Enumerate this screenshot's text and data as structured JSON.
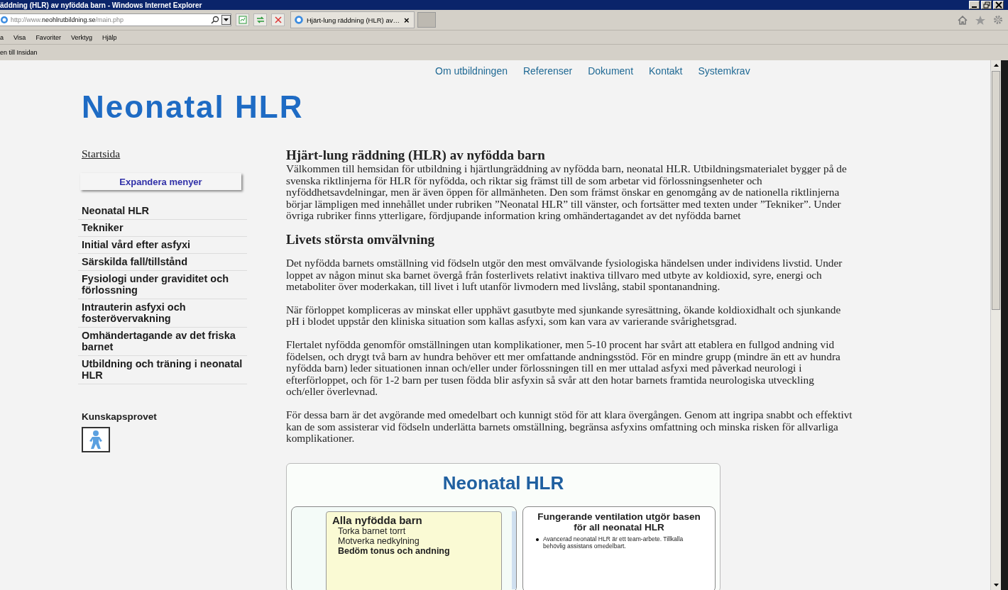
{
  "window": {
    "title": "äddning (HLR) av nyfödda barn - Windows Internet Explorer"
  },
  "address_bar": {
    "scheme": "http://www.",
    "domain": "neohlrutbildning.se",
    "path": "/main.php"
  },
  "tabs": [
    {
      "title": "Hjärt-lung räddning (HLR) av…",
      "selected": true,
      "close": "×"
    }
  ],
  "menu_bar": [
    "a",
    "Visa",
    "Favoriter",
    "Verktyg",
    "Hjälp"
  ],
  "favorites_bar": [
    "en till Insidan"
  ],
  "page": {
    "nav": [
      "Om utbildningen",
      "Referenser",
      "Dokument",
      "Kontakt",
      "Systemkrav"
    ],
    "logo": "Neonatal HLR",
    "sidebar": {
      "home_link": "Startsida",
      "expand_button": "Expandera menyer",
      "items": [
        "Neonatal HLR",
        "Tekniker",
        "Initial vård efter asfyxi",
        "Särskilda fall/tillstånd",
        "Fysiologi under graviditet och förlossning",
        "Intrauterin asfyxi och fosterövervakning",
        "Omhändertagande av det friska barnet",
        "Utbildning och träning i neonatal HLR"
      ],
      "quiz_label": "Kunskapsprovet"
    },
    "sections": [
      {
        "heading": "Hjärt-lung räddning (HLR) av nyfödda barn",
        "paragraphs": [
          "Välkommen till hemsidan för utbildning i hjärtlungräddning av nyfödda barn, neonatal HLR. Utbildningsmaterialet bygger på de svenska riktlinjerna för HLR för nyfödda, och riktar sig främst till de som arbetar vid förlossningsenheter och nyföddhetsavdelningar, men är även öppen för allmänheten. Den som främst önskar en genomgång av de nationella riktlinjerna börjar lämpligen med innehållet under rubriken ”Neonatal HLR” till vänster, och fortsätter med texten under ”Tekniker”. Under övriga rubriker finns ytterligare, fördjupande information kring omhändertagandet av det nyfödda barnet"
        ]
      },
      {
        "heading": "Livets största omvälvning",
        "paragraphs": [
          "Det nyfödda barnets omställning vid födseln utgör den mest omvälvande fysiologiska händelsen under individens livstid. Under loppet av någon minut ska barnet övergå från fosterlivets relativt inaktiva tillvaro med utbyte av koldioxid, syre, energi och metaboliter över moderkakan, till livet i luft utanför livmodern med livslång, stabil spontanandning.",
          "När förloppet kompliceras av minskat eller upphävt gasutbyte med sjunkande syresättning, ökande koldioxidhalt och sjunkande pH i blodet uppstår den kliniska situation som kallas asfyxi, som kan vara av varierande svårighetsgrad.",
          "Flertalet nyfödda genomför omställningen utan komplikationer, men 5-10 procent har svårt att etablera en fullgod andning vid födelsen, och drygt två barn av hundra behöver ett mer omfattande andningsstöd. För en mindre grupp (mindre än ett av hundra nyfödda barn) leder situationen innan och/eller under förlossningen till en mer uttalad asfyxi med påverkad neurologi i efterförloppet, och för 1-2 barn per tusen födda blir asfyxin så svår att den hotar barnets framtida neurologiska utveckling och/eller överlevnad.",
          "För dessa barn är det avgörande med omedelbart och kunnigt stöd för att klara övergången. Genom att ingripa snabbt och effektivt kan de som assisterar vid födseln underlätta barnets omställning, begränsa asfyxins omfattning och minska risken för allvarliga komplikationer."
        ]
      }
    ],
    "diagram": {
      "title": "Neonatal HLR",
      "left_box": {
        "heading": "Alla nyfödda barn",
        "lines": [
          {
            "text": "Torka barnet torrt",
            "bold": false
          },
          {
            "text": "Motverka nedkylning",
            "bold": false
          },
          {
            "text": "Bedöm tonus och andning",
            "bold": true
          }
        ]
      },
      "right_box": {
        "heading": "Fungerande ventilation utgör basen för all neonatal HLR",
        "bullets": [
          "Avancerad neonatal HLR är ett team-arbete. Tillkalla behövlig assistans omedelbart."
        ]
      }
    }
  }
}
